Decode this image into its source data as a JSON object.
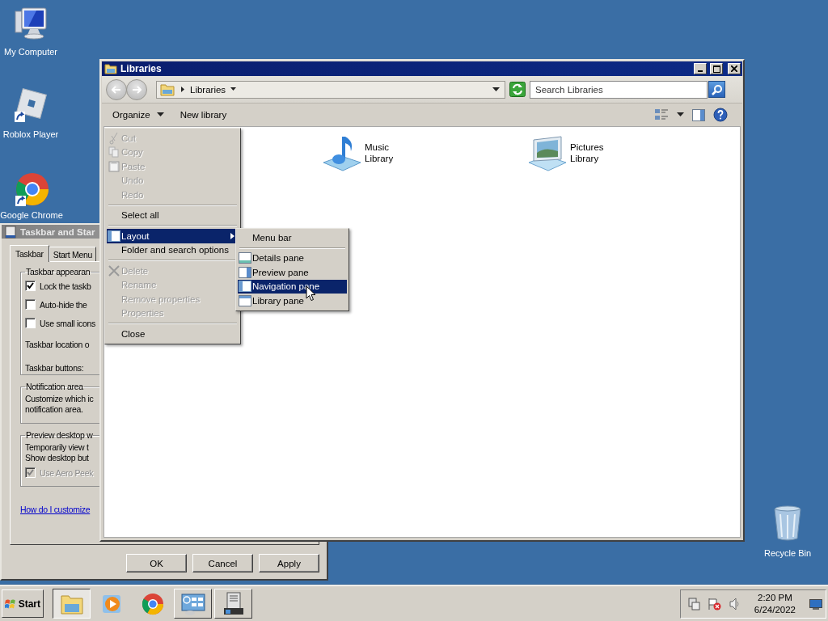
{
  "desktop_icons": [
    {
      "kind": "computer",
      "label": "My Computer"
    },
    {
      "kind": "roblox",
      "label": "Roblox Player"
    },
    {
      "kind": "chrome",
      "label": "Google Chrome"
    },
    {
      "kind": "recycle",
      "label": "Recycle Bin"
    }
  ],
  "dialog": {
    "title": "Taskbar and Star",
    "tabs": [
      {
        "label": "Taskbar",
        "selected": true
      },
      {
        "label": "Start Menu",
        "selected": false
      }
    ],
    "groups": [
      {
        "title": "Taskbar appearan",
        "rows": [
          {
            "kind": "checkbox",
            "label": "Lock the taskb",
            "checked": true,
            "disabled": false
          },
          {
            "kind": "checkbox",
            "label": "Auto-hide the",
            "checked": false,
            "disabled": false
          },
          {
            "kind": "checkbox",
            "label": "Use small icons",
            "checked": false,
            "disabled": false
          },
          {
            "kind": "text",
            "label": "Taskbar location o"
          },
          {
            "kind": "text",
            "label": "Taskbar buttons:"
          }
        ]
      },
      {
        "title": "Notification area",
        "rows": [
          {
            "kind": "line",
            "label": "Customize which ic"
          },
          {
            "kind": "line",
            "label": "notification area."
          }
        ]
      },
      {
        "title": "Preview desktop w",
        "rows": [
          {
            "kind": "line",
            "label": "Temporarily view t"
          },
          {
            "kind": "line",
            "label": "Show desktop but"
          },
          {
            "kind": "checkbox",
            "label": "Use Aero Peek",
            "checked": true,
            "disabled": true
          }
        ]
      }
    ],
    "link": "How do I customize",
    "buttons": [
      "OK",
      "Cancel",
      "Apply"
    ]
  },
  "explorer": {
    "title": "Libraries",
    "address": "Libraries",
    "search_placeholder": "Search Libraries",
    "toolbar": [
      {
        "kind": "dropdown",
        "label": "Organize"
      },
      {
        "kind": "plain",
        "label": "New library"
      }
    ],
    "items": [
      {
        "kind": "music",
        "label": "Music Library"
      },
      {
        "kind": "pictures",
        "label": "Pictures Library"
      }
    ]
  },
  "organize_menu": {
    "groups": [
      [
        {
          "kind": "cut",
          "label": "Cut",
          "disabled": true,
          "selected": false,
          "submenu": false
        },
        {
          "kind": "copy",
          "label": "Copy",
          "disabled": true,
          "selected": false,
          "submenu": false
        },
        {
          "kind": "paste",
          "label": "Paste",
          "disabled": true,
          "selected": false,
          "submenu": false
        },
        {
          "kind": "plain",
          "label": "Undo",
          "disabled": true,
          "selected": false,
          "submenu": false
        },
        {
          "kind": "plain",
          "label": "Redo",
          "disabled": true,
          "selected": false,
          "submenu": false
        }
      ],
      [
        {
          "kind": "plain",
          "label": "Select all",
          "disabled": false,
          "selected": false,
          "submenu": false
        }
      ],
      [
        {
          "kind": "layout",
          "label": "Layout",
          "disabled": false,
          "selected": true,
          "submenu": true
        },
        {
          "kind": "plain",
          "label": "Folder and search options",
          "disabled": false,
          "selected": false,
          "submenu": false
        }
      ],
      [
        {
          "kind": "delete",
          "label": "Delete",
          "disabled": true,
          "selected": false,
          "submenu": false
        },
        {
          "kind": "plain",
          "label": "Rename",
          "disabled": true,
          "selected": false,
          "submenu": false
        },
        {
          "kind": "plain",
          "label": "Remove properties",
          "disabled": true,
          "selected": false,
          "submenu": false
        },
        {
          "kind": "plain",
          "label": "Properties",
          "disabled": true,
          "selected": false,
          "submenu": false
        }
      ],
      [
        {
          "kind": "plain",
          "label": "Close",
          "disabled": false,
          "selected": false,
          "submenu": false
        }
      ]
    ]
  },
  "layout_submenu": {
    "groups": [
      [
        {
          "kind": "plain",
          "label": "Menu bar",
          "selected": false
        }
      ],
      [
        {
          "kind": "details",
          "label": "Details pane",
          "selected": false
        },
        {
          "kind": "preview",
          "label": "Preview pane",
          "selected": false
        },
        {
          "kind": "navigation",
          "label": "Navigation pane",
          "selected": true
        },
        {
          "kind": "library",
          "label": "Library pane",
          "selected": false
        }
      ]
    ]
  },
  "taskbar": {
    "start": "Start",
    "tasks": [
      {
        "kind": "explorer",
        "selected": true,
        "running": true
      },
      {
        "kind": "media",
        "selected": false,
        "running": false
      },
      {
        "kind": "chrome",
        "selected": false,
        "running": false
      },
      {
        "kind": "control",
        "selected": false,
        "running": true
      },
      {
        "kind": "server",
        "selected": false,
        "running": true
      }
    ],
    "time": "2:20 PM",
    "date": "6/24/2022"
  }
}
